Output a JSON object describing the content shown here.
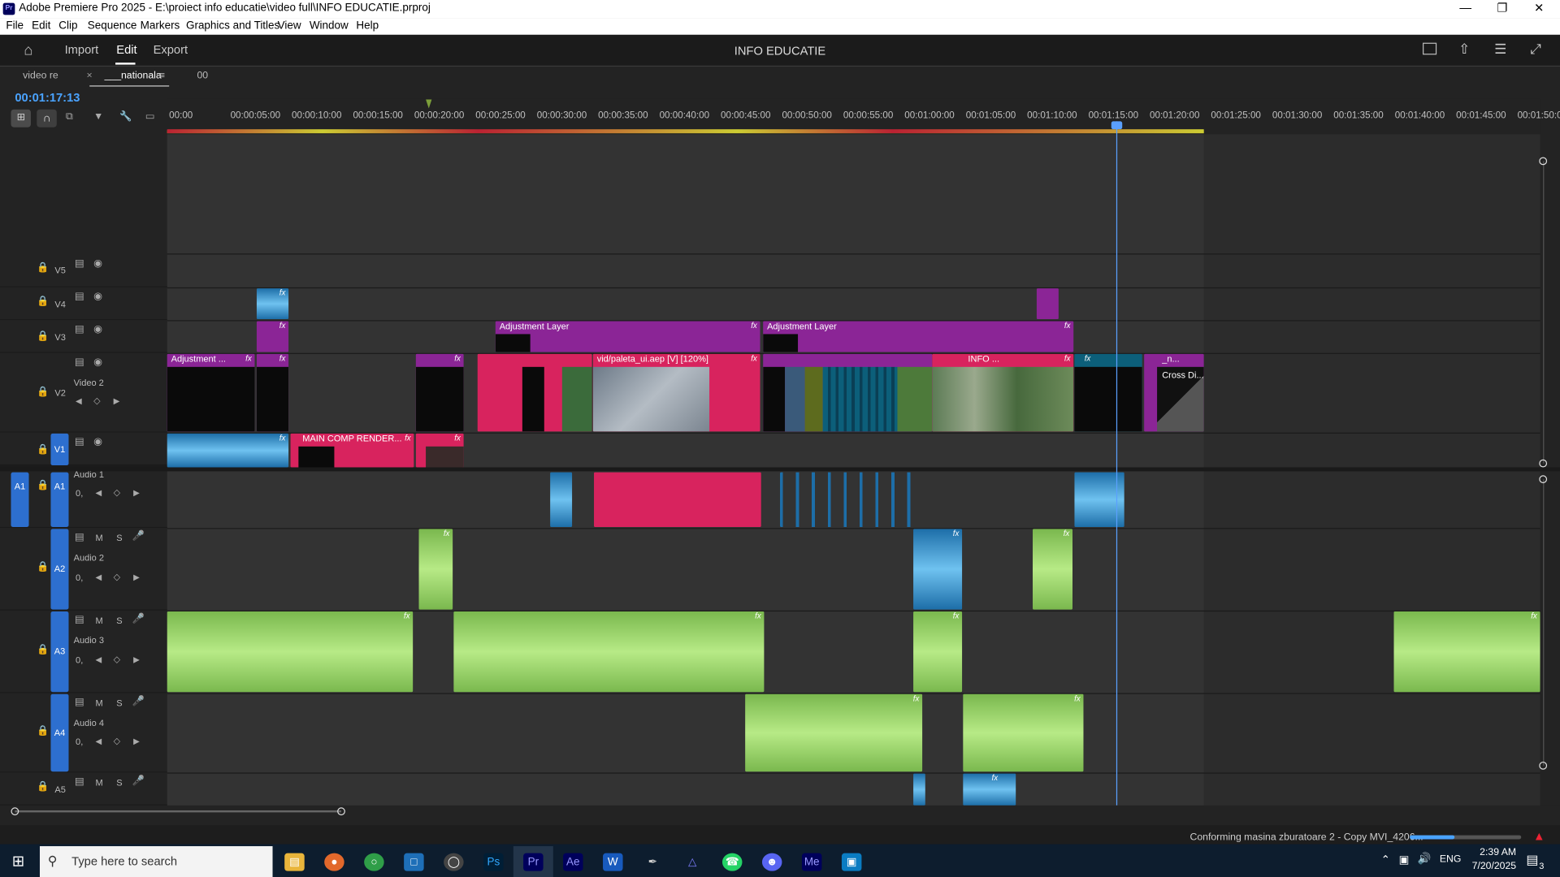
{
  "window": {
    "title": "Adobe Premiere Pro 2025 - E:\\proiect info educatie\\video full\\INFO EDUCATIE.prproj",
    "app_icon": "Pr"
  },
  "menu": [
    "File",
    "Edit",
    "Clip",
    "Sequence",
    "Markers",
    "Graphics and Titles",
    "View",
    "Window",
    "Help"
  ],
  "header": {
    "nav": [
      "Import",
      "Edit",
      "Export"
    ],
    "active": "Edit",
    "project_title": "INFO EDUCATIE"
  },
  "sequence_tabs": [
    "video re",
    "___nationala",
    "00"
  ],
  "timecode": "00:01:17:13",
  "ruler_labels": [
    "00:00",
    "00:00:05:00",
    "00:00:10:00",
    "00:00:15:00",
    "00:00:20:00",
    "00:00:25:00",
    "00:00:30:00",
    "00:00:35:00",
    "00:00:40:00",
    "00:00:45:00",
    "00:00:50:00",
    "00:00:55:00",
    "00:01:00:00",
    "00:01:05:00",
    "00:01:10:00",
    "00:01:15:00",
    "00:01:20:00",
    "00:01:25:00",
    "00:01:30:00",
    "00:01:35:00",
    "00:01:40:00",
    "00:01:45:00",
    "00:01:50:00"
  ],
  "video_tracks": [
    {
      "id": "V5",
      "name": ""
    },
    {
      "id": "V4",
      "name": ""
    },
    {
      "id": "V3",
      "name": ""
    },
    {
      "id": "V2",
      "name": "Video 2"
    },
    {
      "id": "V1",
      "name": ""
    }
  ],
  "audio_tracks": [
    {
      "id": "A1",
      "name": "Audio 1",
      "source": "A1"
    },
    {
      "id": "A2",
      "name": "Audio 2"
    },
    {
      "id": "A3",
      "name": "Audio 3"
    },
    {
      "id": "A4",
      "name": "Audio 4"
    },
    {
      "id": "A5",
      "name": ""
    }
  ],
  "track_buttons": {
    "mute": "M",
    "solo": "S",
    "level": "0,"
  },
  "clip_labels": {
    "v3_adj_1": "Adjustment Layer",
    "v3_adj_2": "Adjustment Layer",
    "v2_adj": "Adjustment ...",
    "v2_vid": "vid/paleta_ui.aep [V] [120%]",
    "v2_info": "INFO ...",
    "v2_n": "_n...",
    "v2_cross": "Cross Di...",
    "v1_main": "MAIN COMP RENDER...",
    "fx": "fx"
  },
  "status": {
    "text": "Conforming masina zburatoare 2 - Copy MVI_4206...",
    "progress": 0.4
  },
  "taskbar": {
    "search_placeholder": "Type here to search",
    "apps": [
      "File Explorer",
      "Firefox",
      "Chrome",
      "Teams",
      "Unity",
      "Ps",
      "Pr",
      "Ae",
      "Word",
      "Pen",
      "Affinity",
      "WhatsApp",
      "Discord",
      "Me",
      "Remote"
    ],
    "language": "ENG",
    "time": "2:39 AM",
    "date": "7/20/2025",
    "notifications": "3"
  }
}
